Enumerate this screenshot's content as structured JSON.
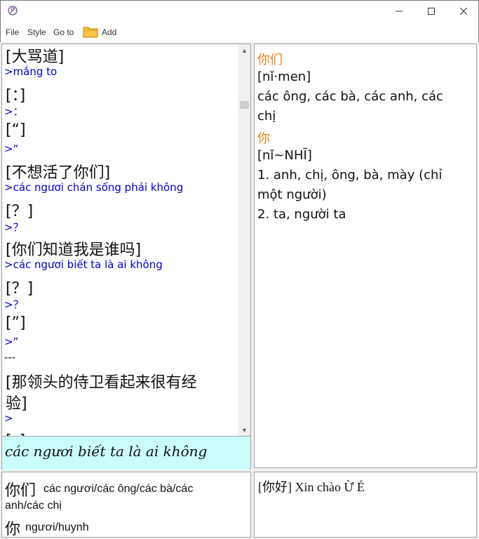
{
  "titlebar": {
    "icon": "app-emblem-icon"
  },
  "menu": {
    "file": "File",
    "style": "Style",
    "goto": "Go to",
    "add": "Add"
  },
  "left_list": {
    "entries": [
      {
        "cn": "[大骂道]",
        "vn": ">mắng to"
      },
      {
        "cn": "[：]",
        "vn": ">："
      },
      {
        "cn": "[“]",
        "vn": ">“"
      },
      {
        "cn": "[不想活了你们]",
        "vn": ">các ngươi chán sống phải không"
      },
      {
        "cn": "[？]",
        "vn": ">？"
      },
      {
        "cn": "[你们知道我是谁吗]",
        "vn": ">các ngươi biết ta là ai không"
      },
      {
        "cn": "[？]",
        "vn": ">？"
      },
      {
        "cn": "[”]",
        "vn": ">”"
      }
    ],
    "separator": "---",
    "last_cn_line1": "[那领头的侍卫看起来很有经",
    "last_cn_line2": "验]",
    "last_vn": ">",
    "partial_cn": "[。]"
  },
  "selected_text": "các ngươi biết ta là ai không",
  "word_list": {
    "w1_cn": "你们",
    "w1_vn_line1": "các ngươi/các ông/các bà/các",
    "w1_vn_line2": "anh/các chị",
    "w2_cn": "你",
    "w2_vn": "ngươi/huynh"
  },
  "dictionary": {
    "head1": "你们",
    "pinyin1": "[nǐ·men]",
    "def1_line1": "các ông, các bà, các anh, các",
    "def1_line2": "chị",
    "head2": "你",
    "pinyin2": "[nǐ~NHĨ]",
    "def2_1_line1": "1. anh, chị, ông, bà, mày (chỉ",
    "def2_1_line2": "một người)",
    "def2_2": "2. ta, người ta"
  },
  "bottom_right_text": "[你好] Xin chào Ừ É",
  "colors": {
    "vn_text": "#0000cc",
    "headword": "#e8841c",
    "selected_bg": "#ccfdfd"
  }
}
